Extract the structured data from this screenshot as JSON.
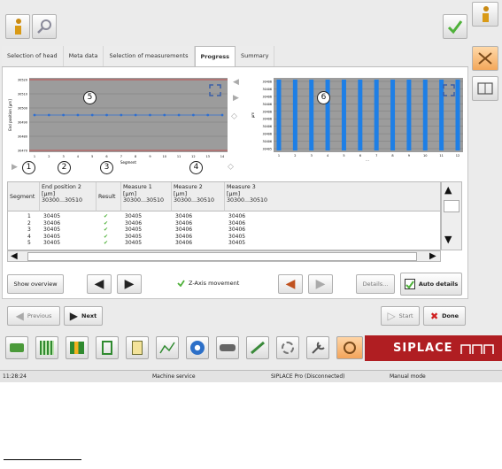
{
  "tabs": [
    "Selection of head",
    "Meta data",
    "Selection of measurements",
    "Progress",
    "Summary"
  ],
  "markers": [
    "1",
    "2",
    "3",
    "4",
    "5",
    "6"
  ],
  "chart_left": {
    "type": "line",
    "ylabel": "End position [µm]",
    "xlabel": "Segment",
    "yticks": [
      "30520",
      "30510",
      "30500",
      "30490",
      "30480",
      "30470"
    ],
    "xticks": [
      "1",
      "2",
      "3",
      "4",
      "5",
      "6",
      "7",
      "8",
      "9",
      "10",
      "11",
      "12",
      "13",
      "14"
    ]
  },
  "chart_right": {
    "type": "bar",
    "ylabel": "µm",
    "xlabel": "...",
    "yticks": [
      "30406",
      "30406",
      "30406",
      "30406",
      "30406",
      "30406",
      "30406",
      "30406",
      "30406",
      "30405"
    ],
    "xticks": [
      "1",
      "2",
      "3",
      "4",
      "5",
      "6",
      "7",
      "8",
      "9",
      "10",
      "11",
      "12"
    ]
  },
  "chart_data": [
    {
      "type": "line",
      "xlabel": "Segment",
      "ylabel": "End position [µm]",
      "x": [
        1,
        2,
        3,
        4,
        5,
        6,
        7,
        8,
        9,
        10,
        11,
        12,
        13,
        14
      ],
      "series": [
        {
          "values": [
            30505,
            30505,
            30505,
            30505,
            30505,
            30505,
            30505,
            30505,
            30505,
            30505,
            30505,
            30505,
            30505,
            30505
          ]
        }
      ],
      "limits": [
        30510,
        30300
      ]
    },
    {
      "type": "bar",
      "ylabel": "µm",
      "categories": [
        "1",
        "2",
        "3",
        "4",
        "5",
        "6",
        "7",
        "8",
        "9",
        "10",
        "11",
        "12"
      ],
      "series": [
        {
          "values": [
            30406,
            30406,
            30406,
            30406,
            30406,
            30406,
            30406,
            30406,
            30406,
            30406,
            30406,
            30406
          ]
        }
      ]
    }
  ],
  "table": {
    "headers": [
      {
        "title": "Segment",
        "unit": "",
        "range": ""
      },
      {
        "title": "End position 2",
        "unit": "[µm]",
        "range": "30300...30510"
      },
      {
        "title": "Result",
        "unit": "",
        "range": ""
      },
      {
        "title": "Measure 1",
        "unit": "[µm]",
        "range": "30300...30510"
      },
      {
        "title": "Measure 2",
        "unit": "[µm]",
        "range": "30300...30510"
      },
      {
        "title": "Measure 3",
        "unit": "[µm]",
        "range": "30300...30510"
      }
    ],
    "rows": [
      {
        "seg": "1",
        "end": "30405",
        "m1": "30405",
        "m2": "30406",
        "m3": "30406"
      },
      {
        "seg": "2",
        "end": "30406",
        "m1": "30406",
        "m2": "30406",
        "m3": "30406"
      },
      {
        "seg": "3",
        "end": "30405",
        "m1": "30405",
        "m2": "30406",
        "m3": "30406"
      },
      {
        "seg": "4",
        "end": "30405",
        "m1": "30405",
        "m2": "30406",
        "m3": "30405"
      },
      {
        "seg": "5",
        "end": "30405",
        "m1": "30405",
        "m2": "30406",
        "m3": "30405"
      }
    ]
  },
  "controls": {
    "show_overview": "Show overview",
    "z_axis": "Z-Axis movement",
    "details": "Details...",
    "auto_details": "Auto details",
    "previous": "Previous",
    "next": "Next",
    "start": "Start",
    "done": "Done"
  },
  "brand": "SIPLACE",
  "status": {
    "time": "11:28:24",
    "machine": "Machine service",
    "connection": "SIPLACE Pro (Disconnected)",
    "mode": "Manual mode"
  },
  "colors": {
    "accent": "#b01e22",
    "bar": "#1e7fe6",
    "check": "#4fb13a"
  }
}
